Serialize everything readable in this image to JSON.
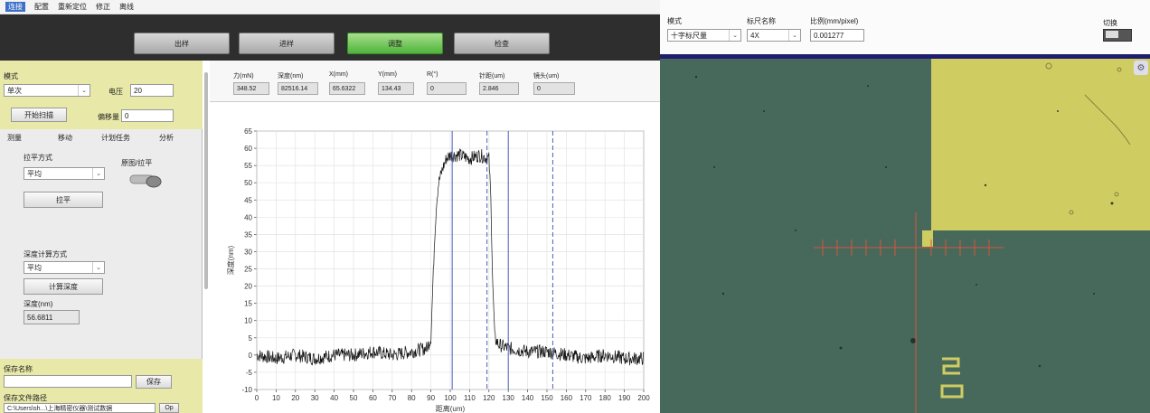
{
  "menu": [
    "连接",
    "配置",
    "重新定位",
    "修正",
    "离线"
  ],
  "actions": [
    "出样",
    "进样",
    "调整",
    "检查"
  ],
  "left": {
    "mode_label": "模式",
    "mode_value": "单次",
    "voltage_label": "电压",
    "voltage_value": "20",
    "start_scan": "开始扫描",
    "offset_label": "偏移量",
    "offset_value": "0",
    "tabs": [
      "测量",
      "移动",
      "计划任务",
      "分析"
    ],
    "level_method_label": "拉平方式",
    "level_method_value": "平均",
    "switch_label": "原图/拉平",
    "level_button": "拉平",
    "depth_method_label": "深度计算方式",
    "depth_method_value": "平均",
    "calc_depth_button": "计算深度",
    "depth_nm_label": "深度(nm)",
    "depth_nm_value": "56.6811",
    "save_name_label": "保存名称",
    "save_button": "保存",
    "save_path_label": "保存文件路径",
    "save_path_value": "C:\\Users\\sh...\\上海精密仪器\\测试数据",
    "open_button": "Op"
  },
  "readouts": [
    {
      "label": "力(mN)",
      "value": "348.52"
    },
    {
      "label": "深度(nm)",
      "value": "82516.14"
    },
    {
      "label": "X(mm)",
      "value": "65.6322"
    },
    {
      "label": "Y(mm)",
      "value": "134.43"
    },
    {
      "label": "R(°)",
      "value": "0"
    },
    {
      "label": "针距(um)",
      "value": "2.846"
    },
    {
      "label": "镜头(um)",
      "value": "0"
    }
  ],
  "chart_data": {
    "type": "line",
    "xlabel": "距离(um)",
    "ylabel": "深度(nm)",
    "xlim": [
      0,
      200
    ],
    "ylim": [
      -10,
      65
    ],
    "xticks": [
      0,
      10,
      20,
      30,
      40,
      50,
      60,
      70,
      80,
      90,
      100,
      110,
      120,
      130,
      140,
      150,
      160,
      170,
      180,
      190,
      200
    ],
    "yticks": [
      -10,
      -5,
      0,
      5,
      10,
      15,
      20,
      25,
      30,
      35,
      40,
      45,
      50,
      55,
      60,
      65
    ],
    "profile": {
      "x": [
        0,
        10,
        20,
        30,
        40,
        50,
        60,
        70,
        80,
        88,
        90,
        91,
        92,
        93,
        94,
        96,
        98,
        100,
        105,
        110,
        115,
        120,
        121,
        122,
        123,
        125,
        130,
        140,
        150,
        160,
        170,
        180,
        190,
        200
      ],
      "y": [
        0,
        -1,
        0,
        -1,
        0,
        0,
        1,
        0,
        1,
        2,
        5,
        20,
        35,
        45,
        50,
        54,
        57,
        58,
        58,
        57,
        58,
        57,
        45,
        20,
        5,
        3,
        2,
        1,
        1,
        0,
        -1,
        0,
        -1,
        -1
      ]
    },
    "markers": [
      {
        "x": 101,
        "style": "solid"
      },
      {
        "x": 119,
        "style": "dashed"
      },
      {
        "x": 130,
        "style": "solid"
      },
      {
        "x": 153,
        "style": "dashed"
      }
    ],
    "grid": true
  },
  "right": {
    "mode_label": "模式",
    "mode_value": "十字标尺量",
    "ruler_label": "标尺名称",
    "ruler_value": "4X",
    "ratio_label": "比例(mm/pixel)",
    "ratio_value": "0.001277",
    "switch_label": "切换"
  },
  "scope": {
    "label_digits": "2",
    "label_box": "0"
  }
}
